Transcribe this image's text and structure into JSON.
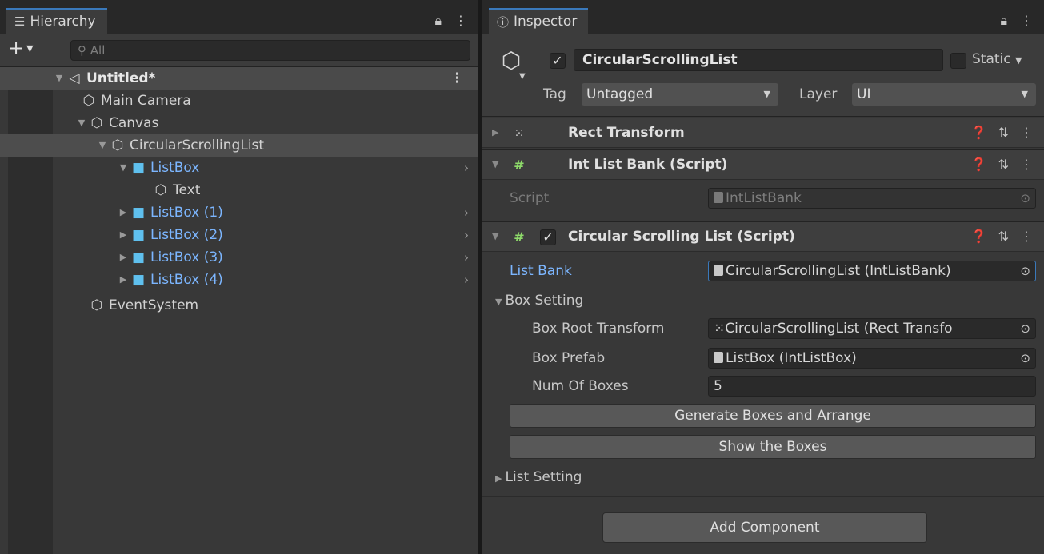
{
  "hierarchy": {
    "tab_label": "Hierarchy",
    "search_placeholder": "All",
    "scene": "Untitled*",
    "items": [
      {
        "label": "Main Camera"
      },
      {
        "label": "Canvas"
      },
      {
        "label": "CircularScrollingList"
      },
      {
        "label": "ListBox"
      },
      {
        "label": "Text"
      },
      {
        "label": "ListBox (1)"
      },
      {
        "label": "ListBox (2)"
      },
      {
        "label": "ListBox (3)"
      },
      {
        "label": "ListBox (4)"
      },
      {
        "label": "EventSystem"
      }
    ]
  },
  "inspector": {
    "tab_label": "Inspector",
    "object_name": "CircularScrollingList",
    "static_label": "Static",
    "tag_label": "Tag",
    "tag_value": "Untagged",
    "layer_label": "Layer",
    "layer_value": "UI",
    "components": [
      {
        "title": "Rect Transform"
      },
      {
        "title": "Int List Bank (Script)"
      },
      {
        "title": "Circular Scrolling List (Script)"
      }
    ],
    "int_list_bank": {
      "script_label": "Script",
      "script_value": "IntListBank"
    },
    "circular_list": {
      "list_bank_label": "List Bank",
      "list_bank_value": "CircularScrollingList (IntListBank)",
      "box_setting_label": "Box Setting",
      "box_root_label": "Box Root Transform",
      "box_root_value": "CircularScrollingList (Rect Transfo",
      "box_prefab_label": "Box Prefab",
      "box_prefab_value": "ListBox (IntListBox)",
      "num_boxes_label": "Num Of Boxes",
      "num_boxes_value": "5",
      "generate_button": "Generate Boxes and Arrange",
      "show_button": "Show the Boxes",
      "list_setting_label": "List Setting"
    },
    "add_component": "Add Component"
  },
  "colors": {
    "panel_bg": "#383838",
    "selection_bg": "#4d4d4d",
    "prefab_blue": "#7cb6ff",
    "tab_accent": "#3a79bb",
    "script_green": "#8edb6a"
  }
}
